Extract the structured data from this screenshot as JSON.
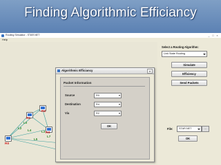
{
  "slide": {
    "title": "Finding Algorithmic Efficiancy"
  },
  "window": {
    "title": "Routing Simulator  - STAR.NET",
    "controls": [
      "_",
      "□",
      "×"
    ]
  },
  "menu": {
    "help": "Help"
  },
  "network": {
    "routers": [
      "R0",
      "R1",
      "R2",
      "R3",
      "R4",
      "R5"
    ],
    "links": [
      "L0",
      "L1",
      "L2",
      "L3",
      "L4",
      "L5",
      "L6",
      "L7"
    ]
  },
  "dialog": {
    "title": "Algorithmic Efficiancy",
    "close": "×",
    "section": "Packet Information",
    "source_label": "Source",
    "source_value": "R0",
    "destination_label": "Destination",
    "destination_value": "R4",
    "via_label": "Via",
    "via_value": "R2",
    "ok": "OK"
  },
  "right_panel": {
    "algorithm_prompt": "Select a Routing Algorithm:",
    "algorithm_value": "Link State Routing",
    "simulate": "Simulate",
    "efficiency": "Efficiency",
    "send_packets": "Send Packets",
    "file_label": "File:",
    "file_value": "STAR.NET",
    "browse": "...",
    "ok": "OK"
  },
  "colors": {
    "slide_bg": "#4a73a8",
    "router_label": "#d02020",
    "link_label": "#2a8a2a",
    "link_line": "#3aa0a0",
    "router_screen": "#2f6fd1"
  }
}
